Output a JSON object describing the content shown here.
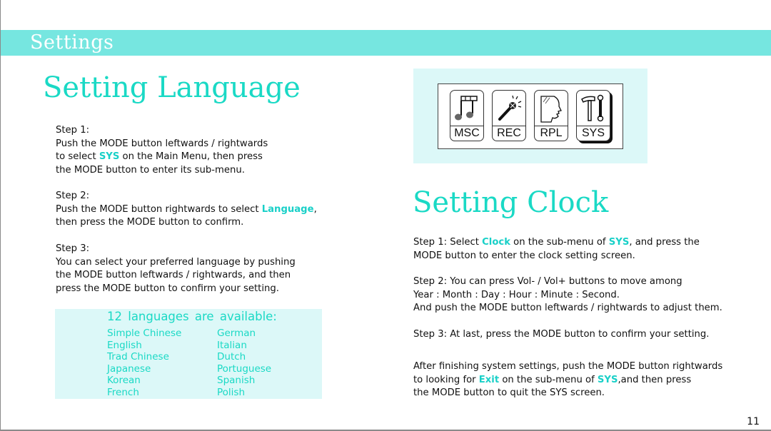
{
  "header": {
    "title": "Settings"
  },
  "colors": {
    "accent": "#1ad9c5",
    "header_bar": "#76e6e0",
    "panel_bg": "#dcf8f8"
  },
  "language_section": {
    "title": "Setting Language",
    "step1": {
      "label": "Step 1:",
      "line1": "Push the MODE button leftwards / rightwards",
      "line2_pre": "to select ",
      "line2_hl": "SYS",
      "line2_post": " on the Main Menu, then press",
      "line3": "the MODE button to enter its sub-menu."
    },
    "step2": {
      "label": "Step 2:",
      "line1_pre": "Push the MODE button rightwards to select ",
      "line1_hl": "Language",
      "line1_post": ",",
      "line2": "then press the MODE button to confirm."
    },
    "step3": {
      "label": "Step 3:",
      "line1": "You can select your preferred language by pushing",
      "line2": "the MODE button leftwards / rightwards, and then",
      "line3": "press the MODE button to confirm your setting."
    },
    "languages_box": {
      "heading": "12 languages are available:",
      "column1": [
        "Simple Chinese",
        "English",
        "Trad Chinese",
        "Japanese",
        "Korean",
        "French"
      ],
      "column2": [
        "German",
        "Italian",
        "Dutch",
        "Portuguese",
        "Spanish",
        "Polish"
      ]
    }
  },
  "main_menu": {
    "items": [
      {
        "label": "MSC",
        "icon": "music-note-icon",
        "selected": false
      },
      {
        "label": "REC",
        "icon": "microphone-icon",
        "selected": false
      },
      {
        "label": "RPL",
        "icon": "speaking-head-icon",
        "selected": false
      },
      {
        "label": "SYS",
        "icon": "tools-icon",
        "selected": true
      }
    ]
  },
  "clock_section": {
    "title": "Setting Clock",
    "step1": {
      "l1_pre": "Step 1: Select ",
      "l1_hl1": "Clock",
      "l1_mid": " on the sub-menu of ",
      "l1_hl2": "SYS",
      "l1_post": ", and press the",
      "line2": "MODE button to enter the clock setting screen."
    },
    "step2": {
      "line1": "Step 2: You can press Vol- / Vol+ buttons to move among",
      "line2": "Year : Month : Day : Hour : Minute : Second.",
      "line3": "And push the MODE button leftwards / rightwards to adjust them."
    },
    "step3": {
      "line1": "Step 3: At last, press the MODE button to confirm your setting."
    },
    "exit_note": {
      "line1": "After finishing system settings, push the MODE button rightwards",
      "l2_pre": "to looking for ",
      "l2_hl1": "Exit",
      "l2_mid": " on the sub-menu of ",
      "l2_hl2": "SYS",
      "l2_post": ",and then press",
      "line3": "the MODE button to quit the SYS screen."
    }
  },
  "page_number": "11"
}
